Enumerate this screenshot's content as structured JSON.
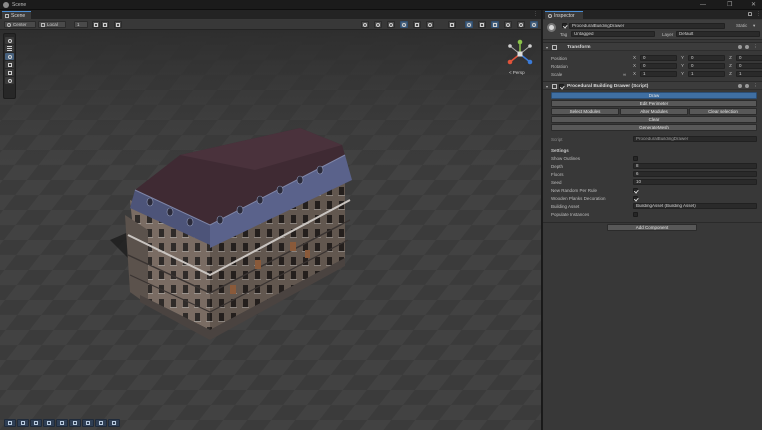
{
  "window": {
    "title": "Scene",
    "controls": [
      "—",
      "❐",
      "✕"
    ]
  },
  "scene": {
    "tab_label": "Scene",
    "toolbar": {
      "pivot_mode": "Center",
      "space_mode": "Local",
      "grid_value": "1"
    },
    "perspective_label": "< Persp",
    "tools": [
      "view-tool",
      "move-tool",
      "rotate-tool",
      "scale-tool",
      "rect-tool",
      "transform-tool"
    ],
    "active_tool_index": 2
  },
  "inspector": {
    "tab_label": "Inspector",
    "object": {
      "name": "ProceduralBuildingDrawer",
      "active": true,
      "static_label": "Static",
      "tag_label": "Tag",
      "tag_value": "Untagged",
      "layer_label": "Layer",
      "layer_value": "Default"
    },
    "transform": {
      "title": "Transform",
      "rows": [
        {
          "label": "Position",
          "x": "0",
          "y": "0",
          "z": "0"
        },
        {
          "label": "Rotation",
          "x": "0",
          "y": "0",
          "z": "0"
        },
        {
          "label": "Scale",
          "x": "1",
          "y": "1",
          "z": "1"
        }
      ],
      "scale_link": "∞"
    },
    "script_component": {
      "title": "Procedural Building Drawer (Script)",
      "enabled": true,
      "buttons": {
        "draw": "Draw",
        "edit_perimeter": "Edit Perimeter",
        "select_modules": "Select Modules",
        "alter_modules": "Alter Modules",
        "clear_selection": "Clear selection",
        "clear": "Clear",
        "generate_mesh": "GenerateMesh"
      },
      "script_label": "Script",
      "script_value": "ProceduralBuildingDrawer",
      "settings_label": "Settings",
      "settings": [
        {
          "label": "Show Outlines",
          "type": "checkbox",
          "checked": false
        },
        {
          "label": "Depth",
          "type": "number",
          "value": "8"
        },
        {
          "label": "Floors",
          "type": "number",
          "value": "6"
        },
        {
          "label": "Seed",
          "type": "number",
          "value": "10"
        },
        {
          "label": "New Random Per Rule",
          "type": "checkbox",
          "checked": true
        },
        {
          "label": "Wooden Planks Decoration",
          "type": "checkbox",
          "checked": true
        },
        {
          "label": "Building Asset",
          "type": "object",
          "value": "BuildingAsset (Building Asset)"
        },
        {
          "label": "Populate Instances",
          "type": "checkbox",
          "checked": false
        }
      ]
    },
    "add_component": "Add Component"
  },
  "colors": {
    "accent_blue": "#3f6fa3",
    "scene_bg": "#3a3a3a",
    "panel_bg": "#383838",
    "roof": "#3e2a32",
    "facade": "#6a5f58"
  }
}
